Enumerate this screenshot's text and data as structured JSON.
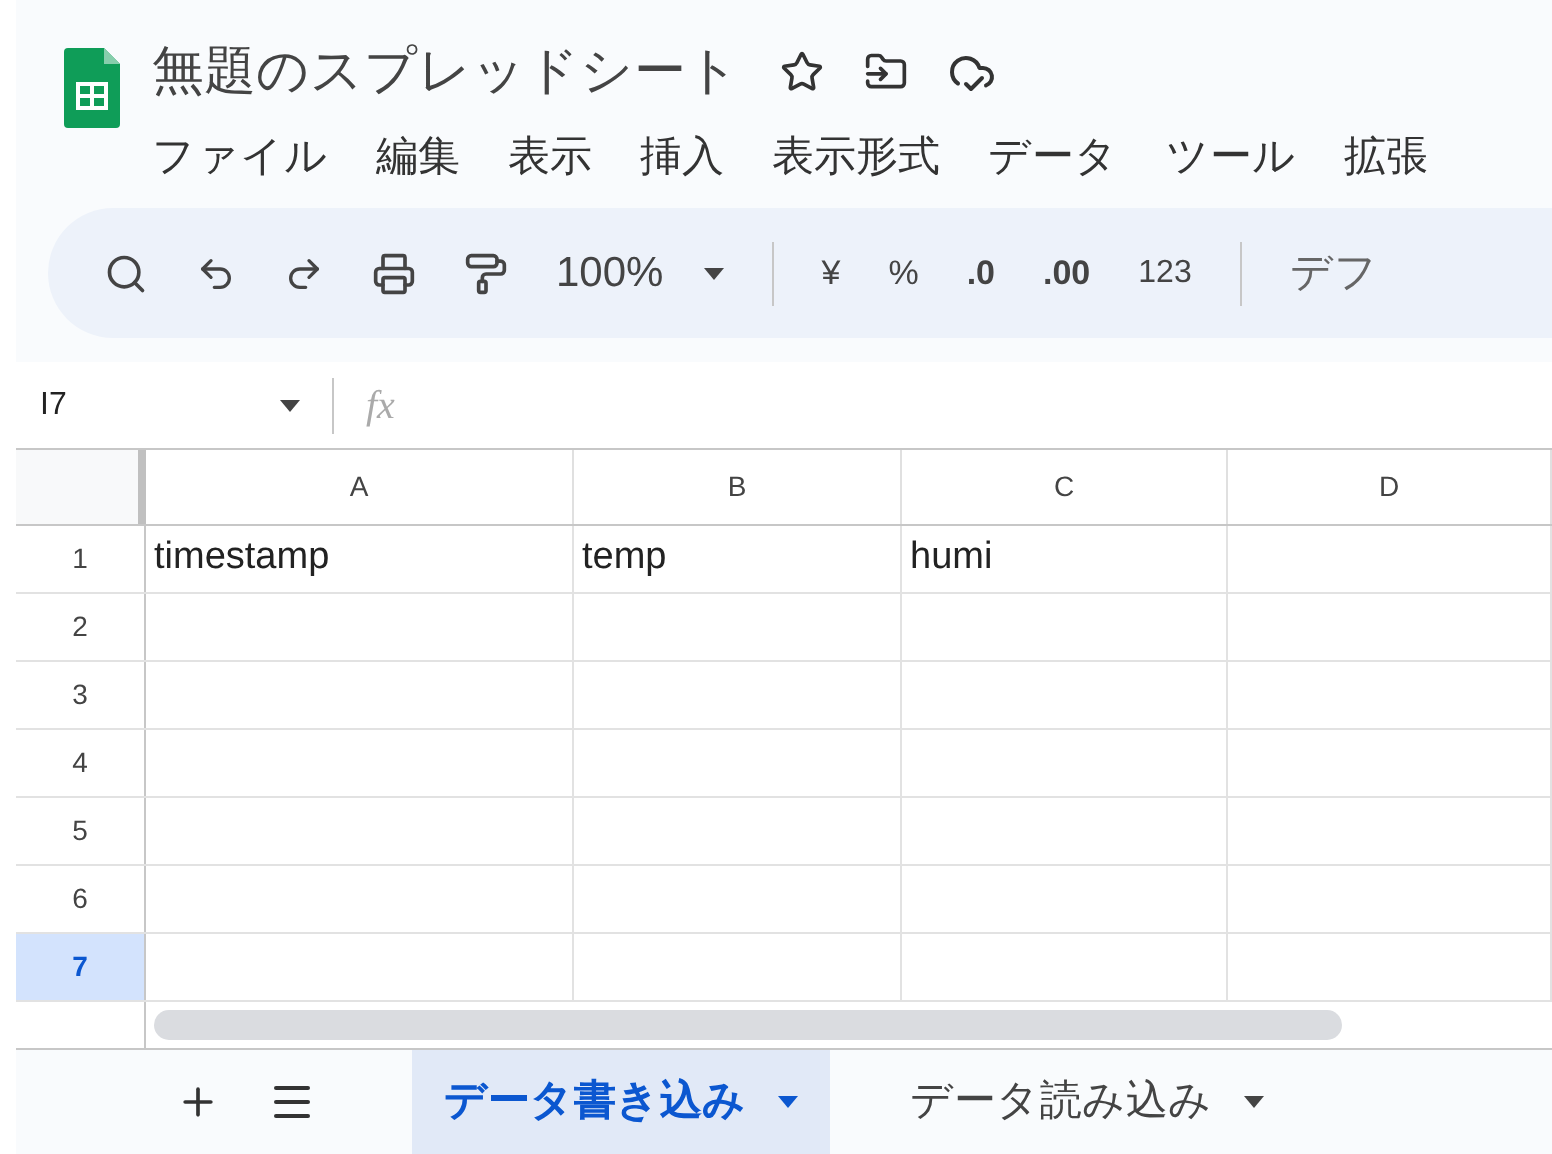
{
  "document": {
    "title": "無題のスプレッドシート"
  },
  "menu": [
    "ファイル",
    "編集",
    "表示",
    "挿入",
    "表示形式",
    "データ",
    "ツール",
    "拡張"
  ],
  "toolbar": {
    "zoom": "100%",
    "currency": "¥",
    "percent": "%",
    "decrease_decimal": ".0",
    "increase_decimal": ".00",
    "number_format": "123",
    "font": "デフ"
  },
  "formula_bar": {
    "cell_reference": "I7",
    "function_label": "fx"
  },
  "table": {
    "columns": [
      "A",
      "B",
      "C",
      "D"
    ],
    "rows": [
      {
        "number": "1",
        "selected": false,
        "cells": [
          "timestamp",
          "temp",
          "humi"
        ]
      },
      {
        "number": "2",
        "selected": false,
        "cells": []
      },
      {
        "number": "3",
        "selected": false,
        "cells": []
      },
      {
        "number": "4",
        "selected": false,
        "cells": []
      },
      {
        "number": "5",
        "selected": false,
        "cells": []
      },
      {
        "number": "6",
        "selected": false,
        "cells": []
      },
      {
        "number": "7",
        "selected": true,
        "cells": []
      }
    ]
  },
  "sheet_tabs": [
    {
      "label": "データ書き込み",
      "selected": true
    },
    {
      "label": "データ読み込み",
      "selected": false
    }
  ]
}
